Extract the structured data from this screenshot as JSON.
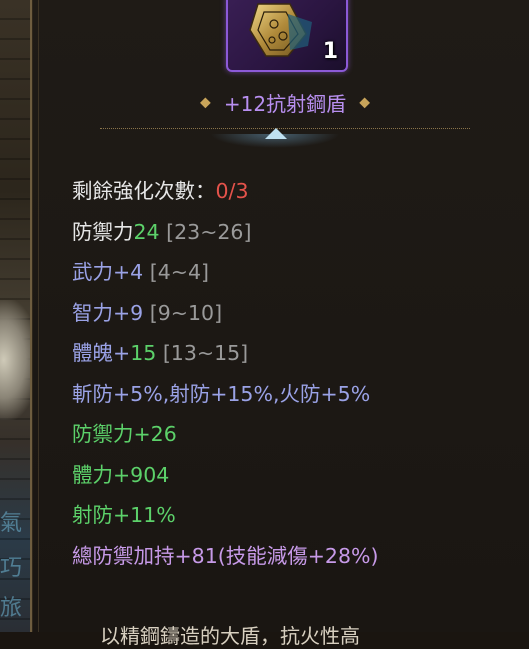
{
  "item": {
    "name": "+12抗射鋼盾",
    "count": "1"
  },
  "stats": {
    "enhance": {
      "label": "剩餘強化次數：",
      "value": "0/3"
    },
    "defense": {
      "label": "防禦力",
      "value": "24",
      "range": "[23~26]"
    },
    "wuli": {
      "text": "武力+4",
      "range": "[4~4]"
    },
    "zhili": {
      "text": "智力+9",
      "range": "[9~10]"
    },
    "tipo": {
      "label": "體魄+",
      "value": "15",
      "range": "[13~15]"
    },
    "resist": "斬防+5%,射防+15%,火防+5%",
    "bonus": [
      "防禦力+26",
      "體力+904",
      "射防+11%"
    ],
    "total": "總防禦加持+81(技能減傷+28%)"
  },
  "flavor_text": "以精鋼鑄造的大盾，抗火性高",
  "colors": {
    "rarity_purple": "#b88ff0",
    "bonus_green": "#5cd16a",
    "warning_red": "#e5534b",
    "stat_blue": "#9aa2e6",
    "total_pink": "#c79ae8"
  }
}
